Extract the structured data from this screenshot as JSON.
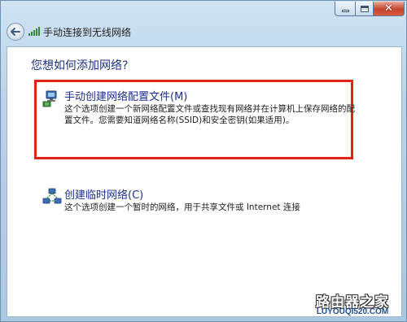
{
  "window": {
    "title": "手动连接到无线网络",
    "controls": {
      "minimize_icon": "minimize-icon",
      "maximize_icon": "maximize-icon",
      "close_glyph": "✕"
    }
  },
  "main": {
    "heading": "您想如何添加网络?",
    "options": [
      {
        "title": "手动创建网络配置文件(M)",
        "description": "这个选项创建一个新网络配置文件或查找现有网络并在计算机上保存网络的配置文件。您需要知道网络名称(SSID)和安全密钥(如果适用)。",
        "icon": "network-profile-icon"
      },
      {
        "title": "创建临时网络(C)",
        "description": "这个选项创建一个暂时的网络，用于共享文件或 Internet 连接",
        "icon": "adhoc-network-icon"
      }
    ]
  },
  "watermark": {
    "line1": "路由器之家",
    "line2": "LUYOUQI520.COM"
  },
  "colors": {
    "highlight_border": "#e2231a",
    "heading": "#1e3287",
    "link_title": "#1b2f8f"
  }
}
